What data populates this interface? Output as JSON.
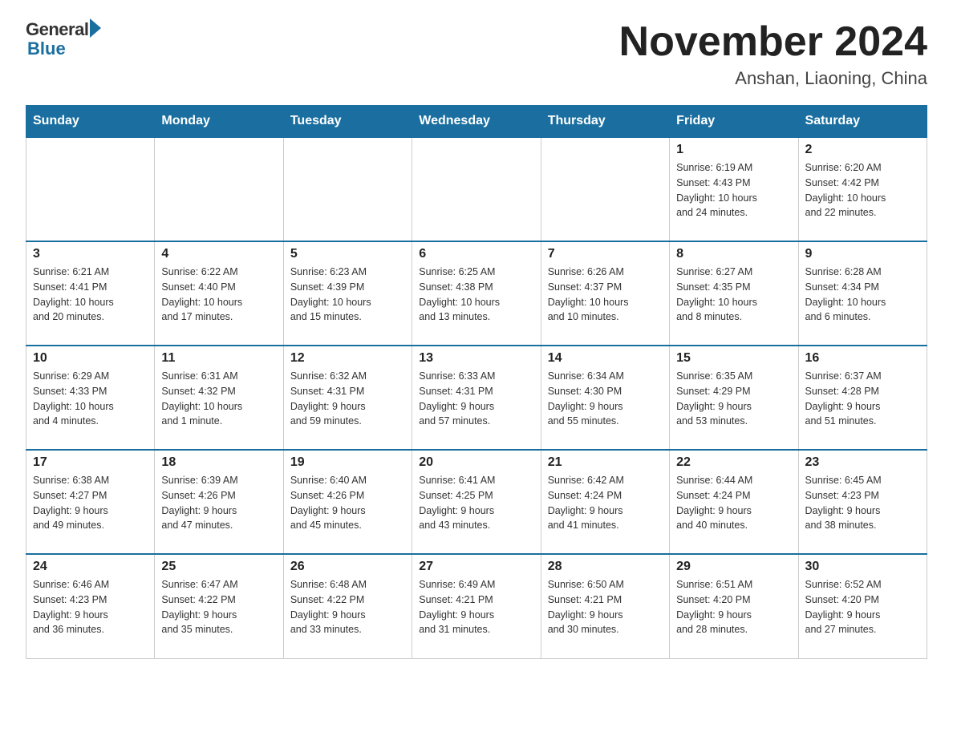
{
  "logo": {
    "general": "General",
    "blue": "Blue"
  },
  "title": "November 2024",
  "location": "Anshan, Liaoning, China",
  "weekdays": [
    "Sunday",
    "Monday",
    "Tuesday",
    "Wednesday",
    "Thursday",
    "Friday",
    "Saturday"
  ],
  "weeks": [
    [
      {
        "day": "",
        "info": ""
      },
      {
        "day": "",
        "info": ""
      },
      {
        "day": "",
        "info": ""
      },
      {
        "day": "",
        "info": ""
      },
      {
        "day": "",
        "info": ""
      },
      {
        "day": "1",
        "info": "Sunrise: 6:19 AM\nSunset: 4:43 PM\nDaylight: 10 hours\nand 24 minutes."
      },
      {
        "day": "2",
        "info": "Sunrise: 6:20 AM\nSunset: 4:42 PM\nDaylight: 10 hours\nand 22 minutes."
      }
    ],
    [
      {
        "day": "3",
        "info": "Sunrise: 6:21 AM\nSunset: 4:41 PM\nDaylight: 10 hours\nand 20 minutes."
      },
      {
        "day": "4",
        "info": "Sunrise: 6:22 AM\nSunset: 4:40 PM\nDaylight: 10 hours\nand 17 minutes."
      },
      {
        "day": "5",
        "info": "Sunrise: 6:23 AM\nSunset: 4:39 PM\nDaylight: 10 hours\nand 15 minutes."
      },
      {
        "day": "6",
        "info": "Sunrise: 6:25 AM\nSunset: 4:38 PM\nDaylight: 10 hours\nand 13 minutes."
      },
      {
        "day": "7",
        "info": "Sunrise: 6:26 AM\nSunset: 4:37 PM\nDaylight: 10 hours\nand 10 minutes."
      },
      {
        "day": "8",
        "info": "Sunrise: 6:27 AM\nSunset: 4:35 PM\nDaylight: 10 hours\nand 8 minutes."
      },
      {
        "day": "9",
        "info": "Sunrise: 6:28 AM\nSunset: 4:34 PM\nDaylight: 10 hours\nand 6 minutes."
      }
    ],
    [
      {
        "day": "10",
        "info": "Sunrise: 6:29 AM\nSunset: 4:33 PM\nDaylight: 10 hours\nand 4 minutes."
      },
      {
        "day": "11",
        "info": "Sunrise: 6:31 AM\nSunset: 4:32 PM\nDaylight: 10 hours\nand 1 minute."
      },
      {
        "day": "12",
        "info": "Sunrise: 6:32 AM\nSunset: 4:31 PM\nDaylight: 9 hours\nand 59 minutes."
      },
      {
        "day": "13",
        "info": "Sunrise: 6:33 AM\nSunset: 4:31 PM\nDaylight: 9 hours\nand 57 minutes."
      },
      {
        "day": "14",
        "info": "Sunrise: 6:34 AM\nSunset: 4:30 PM\nDaylight: 9 hours\nand 55 minutes."
      },
      {
        "day": "15",
        "info": "Sunrise: 6:35 AM\nSunset: 4:29 PM\nDaylight: 9 hours\nand 53 minutes."
      },
      {
        "day": "16",
        "info": "Sunrise: 6:37 AM\nSunset: 4:28 PM\nDaylight: 9 hours\nand 51 minutes."
      }
    ],
    [
      {
        "day": "17",
        "info": "Sunrise: 6:38 AM\nSunset: 4:27 PM\nDaylight: 9 hours\nand 49 minutes."
      },
      {
        "day": "18",
        "info": "Sunrise: 6:39 AM\nSunset: 4:26 PM\nDaylight: 9 hours\nand 47 minutes."
      },
      {
        "day": "19",
        "info": "Sunrise: 6:40 AM\nSunset: 4:26 PM\nDaylight: 9 hours\nand 45 minutes."
      },
      {
        "day": "20",
        "info": "Sunrise: 6:41 AM\nSunset: 4:25 PM\nDaylight: 9 hours\nand 43 minutes."
      },
      {
        "day": "21",
        "info": "Sunrise: 6:42 AM\nSunset: 4:24 PM\nDaylight: 9 hours\nand 41 minutes."
      },
      {
        "day": "22",
        "info": "Sunrise: 6:44 AM\nSunset: 4:24 PM\nDaylight: 9 hours\nand 40 minutes."
      },
      {
        "day": "23",
        "info": "Sunrise: 6:45 AM\nSunset: 4:23 PM\nDaylight: 9 hours\nand 38 minutes."
      }
    ],
    [
      {
        "day": "24",
        "info": "Sunrise: 6:46 AM\nSunset: 4:23 PM\nDaylight: 9 hours\nand 36 minutes."
      },
      {
        "day": "25",
        "info": "Sunrise: 6:47 AM\nSunset: 4:22 PM\nDaylight: 9 hours\nand 35 minutes."
      },
      {
        "day": "26",
        "info": "Sunrise: 6:48 AM\nSunset: 4:22 PM\nDaylight: 9 hours\nand 33 minutes."
      },
      {
        "day": "27",
        "info": "Sunrise: 6:49 AM\nSunset: 4:21 PM\nDaylight: 9 hours\nand 31 minutes."
      },
      {
        "day": "28",
        "info": "Sunrise: 6:50 AM\nSunset: 4:21 PM\nDaylight: 9 hours\nand 30 minutes."
      },
      {
        "day": "29",
        "info": "Sunrise: 6:51 AM\nSunset: 4:20 PM\nDaylight: 9 hours\nand 28 minutes."
      },
      {
        "day": "30",
        "info": "Sunrise: 6:52 AM\nSunset: 4:20 PM\nDaylight: 9 hours\nand 27 minutes."
      }
    ]
  ]
}
